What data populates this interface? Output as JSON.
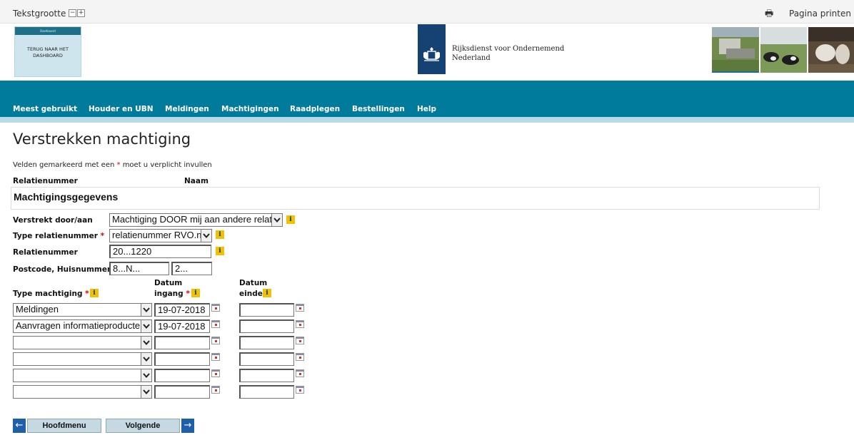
{
  "topbar": {
    "text_size_label": "Tekstgrootte",
    "decrease_glyph": "−",
    "increase_glyph": "+",
    "print_icon": "printer-icon",
    "print_label": "Pagina printen"
  },
  "dashboard": {
    "top_text": "Dashboard",
    "line1": "TERUG NAAR HET",
    "line2": "DASHBOARD"
  },
  "org": {
    "line1": "Rijksdienst voor Ondernemend",
    "line2": "Nederland"
  },
  "nav": {
    "items": [
      "Meest gebruikt",
      "Houder en UBN",
      "Meldingen",
      "Machtigingen",
      "Raadplegen",
      "Bestellingen",
      "Help"
    ]
  },
  "page": {
    "title": "Verstrekken machtiging",
    "hint_prefix": "Velden gemarkeerd met een ",
    "hint_star": "*",
    "hint_suffix": " moet u verplicht invullen"
  },
  "summary": {
    "relatienummer_label": "Relatienummer",
    "naam_label": "Naam"
  },
  "section": {
    "title": "Machtigingsgegevens"
  },
  "form": {
    "verstrekt_label": "Verstrekt door/aan",
    "verstrekt_value": "Machtiging DOOR mij aan andere relatie",
    "type_rel_label": "Type relatienummer",
    "type_rel_value": "relatienummer RVO.nl",
    "relnr_label": "Relatienummer",
    "relnr_value": "20...1220",
    "postcode_label": "Postcode, Huisnummer",
    "postcode_value": "8...N...",
    "huisnummer_value": "2..."
  },
  "columns": {
    "type_label": "Type machtiging",
    "ingang_line1": "Datum",
    "ingang_line2": "ingang",
    "einde_line1": "Datum",
    "einde_line2": "einde"
  },
  "rows": [
    {
      "type": "Meldingen",
      "ingang": "19-07-2018",
      "einde": ""
    },
    {
      "type": "Aanvragen informatieproducten",
      "ingang": "19-07-2018",
      "einde": ""
    },
    {
      "type": "",
      "ingang": "",
      "einde": ""
    },
    {
      "type": "",
      "ingang": "",
      "einde": ""
    },
    {
      "type": "",
      "ingang": "",
      "einde": ""
    },
    {
      "type": "",
      "ingang": "",
      "einde": ""
    }
  ],
  "footer": {
    "back_label": "Hoofdmenu",
    "next_label": "Volgende",
    "back_arrow": "←",
    "next_arrow": "→"
  }
}
